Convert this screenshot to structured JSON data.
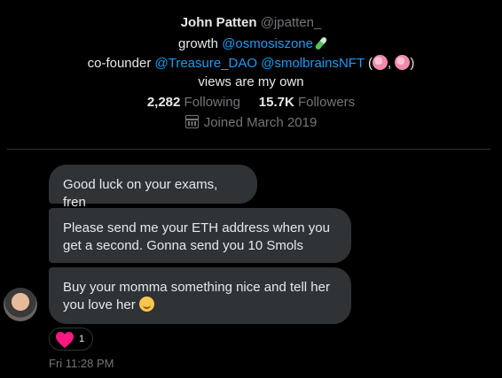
{
  "profile": {
    "name": "John Patten",
    "handle": "@jpatten_",
    "bio_line1_prefix": "growth ",
    "bio_line1_link": "@osmosiszone",
    "bio_line2_prefix": "co-founder ",
    "bio_line2_link1": "@Treasure_DAO",
    "bio_line2_link2": "@smolbrainsNFT",
    "bio_line2_open": " (",
    "bio_line2_sep": ", ",
    "bio_line2_close": ")",
    "bio_line3": "views are my own",
    "following_count": "2,282",
    "following_label": "Following",
    "followers_count": "15.7K",
    "followers_label": "Followers",
    "joined": "Joined March 2019"
  },
  "messages": [
    {
      "text": "Good luck on your exams, fren"
    },
    {
      "text": "Please send me your ETH address when you get a second. Gonna send you 10 Smols"
    },
    {
      "text": "Buy your momma something nice and tell her you love her "
    }
  ],
  "reaction": {
    "count": "1",
    "color": "#f91880"
  },
  "timestamp": "Fri 11:28 PM",
  "colors": {
    "link": "#1d9bf0",
    "bubble": "#2f3336",
    "muted": "#71767b"
  }
}
